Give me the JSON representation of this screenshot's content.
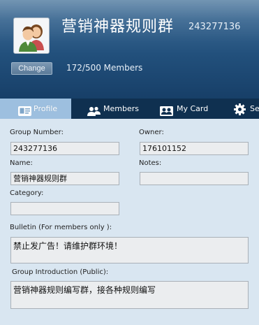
{
  "header": {
    "group_name": "营销神器规则群",
    "group_number": "243277136",
    "change_label": "Change",
    "member_count": "172/500 Members"
  },
  "tabs": [
    {
      "label": "Profile",
      "icon": "id-card-icon"
    },
    {
      "label": "Members",
      "icon": "people-icon"
    },
    {
      "label": "My Card",
      "icon": "contact-card-icon"
    },
    {
      "label": "Se",
      "icon": "gear-icon"
    }
  ],
  "profile": {
    "group_number_label": "Group Number:",
    "group_number_value": "243277136",
    "owner_label": "Owner:",
    "owner_value": "176101152",
    "name_label": "Name:",
    "name_value": "营销神器规则群",
    "notes_label": "Notes:",
    "notes_value": "",
    "category_label": "Category:",
    "category_value": "",
    "bulletin_label": "Bulletin (For members only ):",
    "bulletin_value": "禁止发广告！请维护群环境！",
    "intro_label": "Group Introduction (Public):",
    "intro_value": "营销神器规则编写群，接各种规则编写"
  },
  "colors": {
    "header_top": "#3a6791",
    "header_bottom": "#173f68",
    "tabbar": "#0f3050",
    "active_tab": "#9dbfdf",
    "content_bg": "#d9e6f1"
  }
}
